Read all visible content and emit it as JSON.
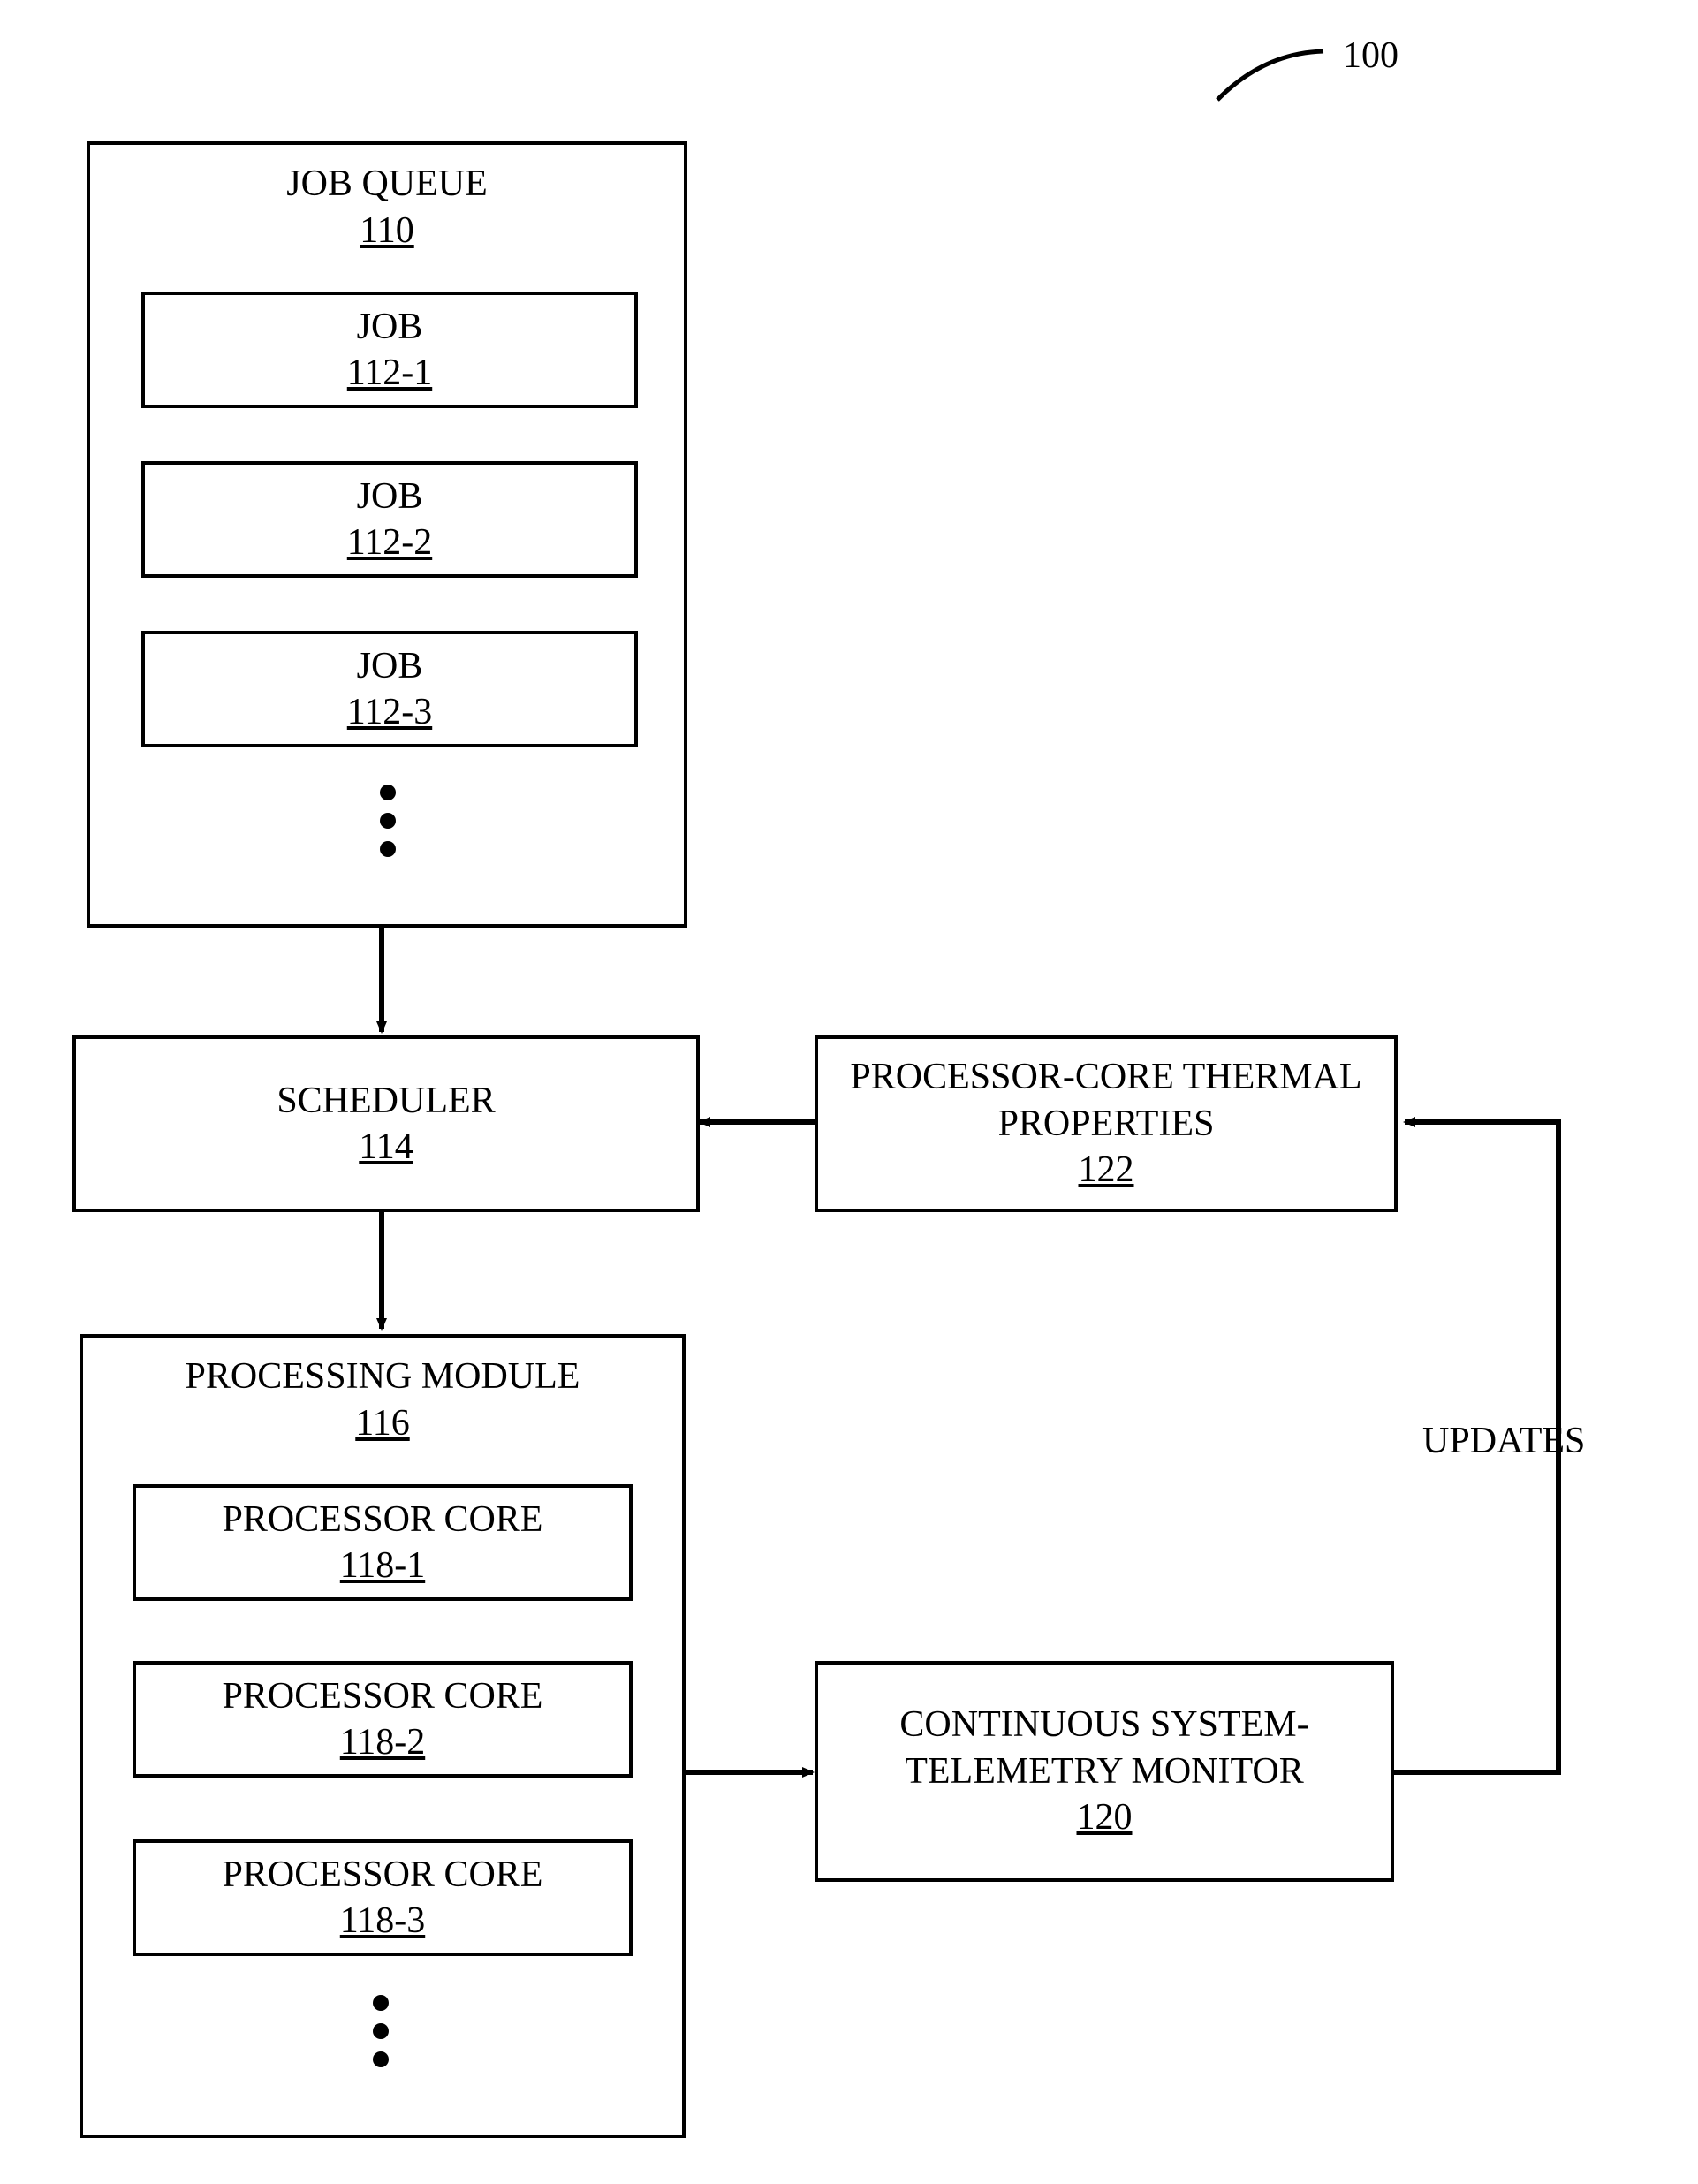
{
  "figure_ref": "100",
  "job_queue": {
    "title": "JOB QUEUE",
    "num": "110",
    "jobs": [
      {
        "title": "JOB",
        "num": "112-1"
      },
      {
        "title": "JOB",
        "num": "112-2"
      },
      {
        "title": "JOB",
        "num": "112-3"
      }
    ]
  },
  "scheduler": {
    "title": "SCHEDULER",
    "num": "114"
  },
  "processing_module": {
    "title": "PROCESSING MODULE",
    "num": "116",
    "cores": [
      {
        "title": "PROCESSOR CORE",
        "num": "118-1"
      },
      {
        "title": "PROCESSOR CORE",
        "num": "118-2"
      },
      {
        "title": "PROCESSOR CORE",
        "num": "118-3"
      }
    ]
  },
  "thermal_props": {
    "title": "PROCESSOR-CORE THERMAL PROPERTIES",
    "num": "122"
  },
  "telemetry": {
    "title": "CONTINUOUS SYSTEM-TELEMETRY MONITOR",
    "num": "120"
  },
  "updates_label": "UPDATES"
}
